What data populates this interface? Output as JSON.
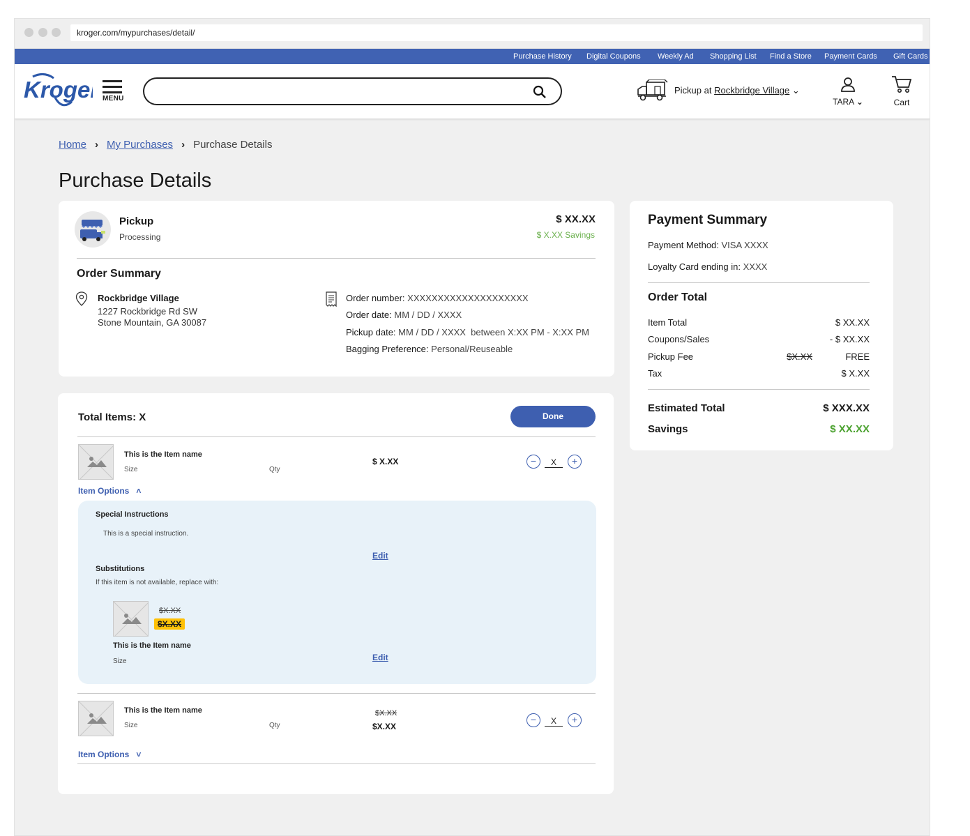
{
  "browser": {
    "url": "kroger.com/mypurchases/detail/"
  },
  "top_nav": [
    "Purchase History",
    "Digital Coupons",
    "Weekly Ad",
    "Shopping List",
    "Find a Store",
    "Payment Cards",
    "Gift Cards"
  ],
  "header": {
    "logo_text": "Kroger",
    "menu_label": "MENU",
    "search_placeholder": "",
    "pickup_prefix": "Pickup at",
    "pickup_store": "Rockbridge Village",
    "account_label": "TARA",
    "cart_label": "Cart"
  },
  "breadcrumb": {
    "home": "Home",
    "purchases": "My Purchases",
    "current": "Purchase Details"
  },
  "page_title": "Purchase Details",
  "order": {
    "type": "Pickup",
    "status": "Processing",
    "price": "$ XX.XX",
    "savings": "$ X.XX Savings",
    "summary_title": "Order Summary",
    "store_name": "Rockbridge Village",
    "address_line1": "1227 Rockbridge Rd SW",
    "address_line2": "Stone Mountain, GA 30087",
    "number_label": "Order number:",
    "number_value": "XXXXXXXXXXXXXXXXXXXX",
    "date_label": "Order date:",
    "date_value": "MM / DD / XXXX",
    "pickup_label": "Pickup date:",
    "pickup_value": "MM / DD / XXXX  between X:XX PM - X:XX PM",
    "bagging_label": "Bagging Preference:",
    "bagging_value": "Personal/Reuseable"
  },
  "items": {
    "total_label": "Total Items: X",
    "done_label": "Done",
    "options_label": "Item Options",
    "list": [
      {
        "name": "This is the Item name",
        "size": "Size",
        "qty_label": "Qty",
        "price": "$ X.XX",
        "old_price": "",
        "qty": "X"
      },
      {
        "name": "This is the Item name",
        "size": "Size",
        "qty_label": "Qty",
        "price": "$X.XX",
        "old_price": "$X.XX",
        "qty": "X"
      }
    ],
    "panel": {
      "special_title": "Special Instructions",
      "special_text": "This is a special instruction.",
      "edit_label": "Edit",
      "subs_title": "Substitutions",
      "subs_text": "If this item is not available, replace with:",
      "sub_old_price": "$X.XX",
      "sub_new_price": "$X.XX",
      "sub_name": "This is the Item name",
      "sub_size": "Size"
    }
  },
  "payment": {
    "title": "Payment Summary",
    "method_label": "Payment Method:",
    "method_value": "VISA XXXX",
    "loyalty_label": "Loyalty Card ending in:",
    "loyalty_value": "XXXX",
    "order_total_title": "Order Total",
    "item_total_label": "Item Total",
    "item_total_value": "$ XX.XX",
    "coupons_label": "Coupons/Sales",
    "coupons_value": "- $ XX.XX",
    "fee_label": "Pickup Fee",
    "fee_old": "$X.XX",
    "fee_value": "FREE",
    "tax_label": "Tax",
    "tax_value": "$ X.XX",
    "estimated_label": "Estimated Total",
    "estimated_value": "$ XXX.XX",
    "savings_label": "Savings",
    "savings_value": "$ XX.XX"
  },
  "colors": {
    "brand_blue": "#3e5fb0",
    "nav_blue": "#4062b3",
    "savings_green": "#4aa12e",
    "sale_yellow": "#ffc107",
    "panel_bg": "#e8f2f9"
  }
}
